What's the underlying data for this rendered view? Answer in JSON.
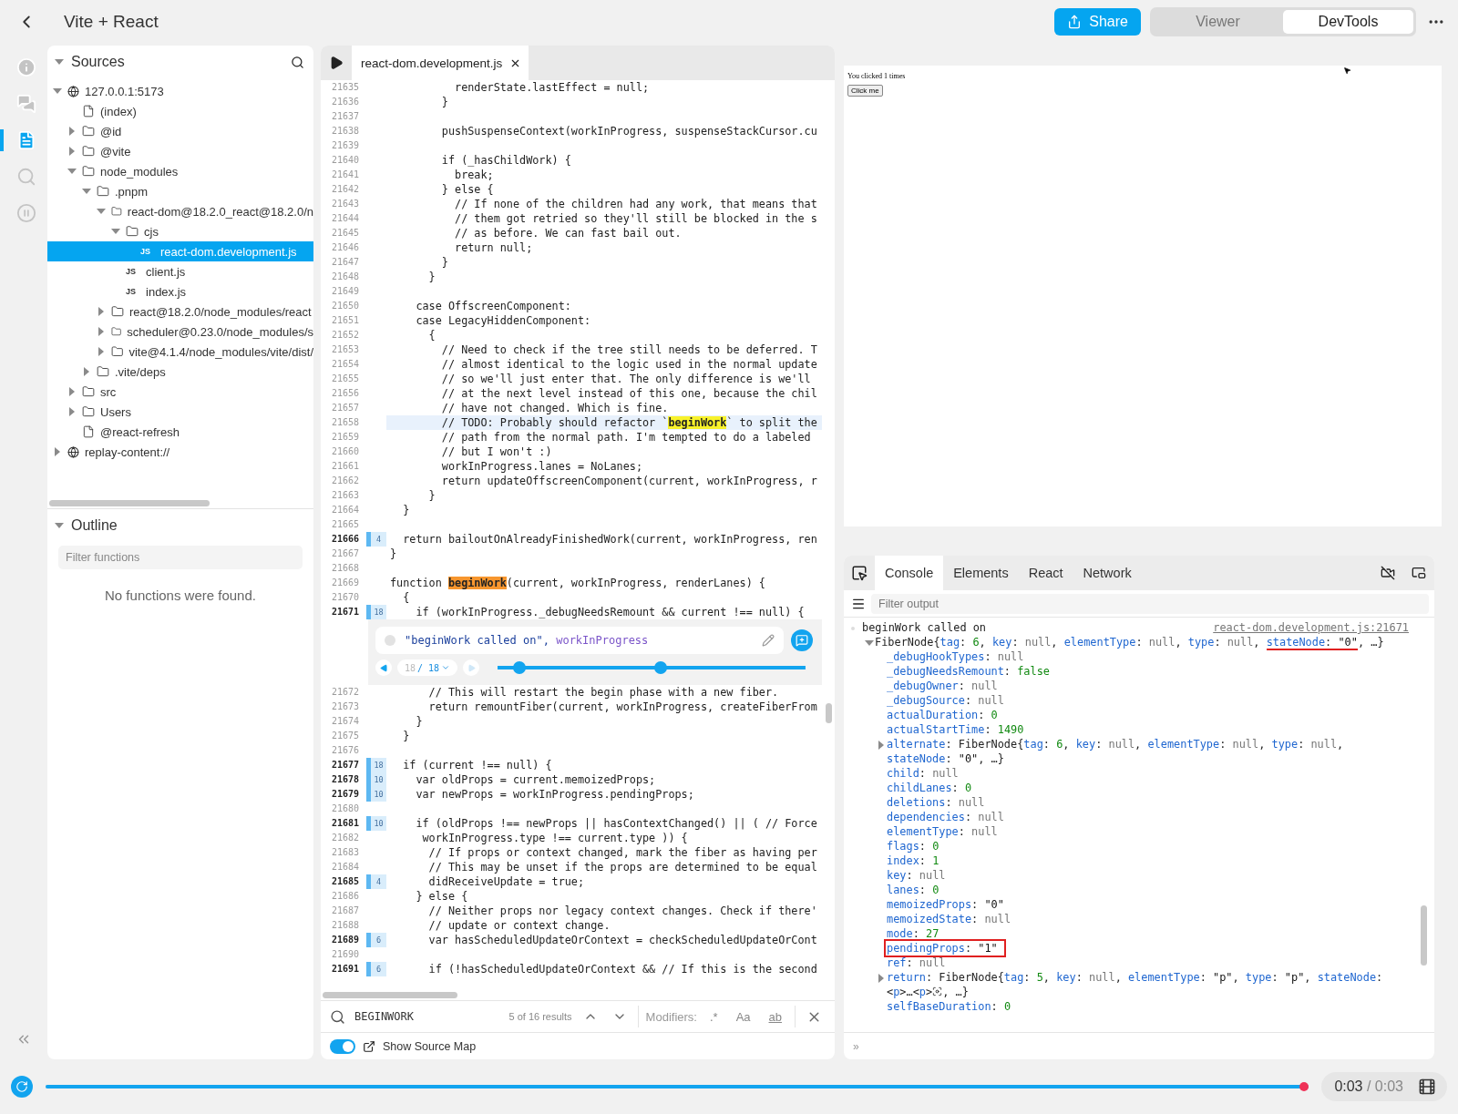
{
  "header": {
    "title": "Vite + React",
    "share": "Share",
    "modes": [
      {
        "label": "Viewer",
        "selected": false
      },
      {
        "label": "DevTools",
        "selected": true
      }
    ]
  },
  "rail": [
    {
      "kind": "info",
      "selected": false
    },
    {
      "kind": "comments",
      "selected": false
    },
    {
      "kind": "sources",
      "selected": true
    },
    {
      "kind": "search",
      "selected": false
    },
    {
      "kind": "pause",
      "selected": false
    }
  ],
  "sources": {
    "title": "Sources",
    "tree": [
      {
        "kind": "origin",
        "label": "127.0.0.1:5173",
        "expanded": true,
        "selected": false,
        "children": [
          {
            "kind": "file",
            "label": "(index)",
            "selected": false
          },
          {
            "kind": "folder",
            "label": "@id",
            "expanded": false,
            "selected": false
          },
          {
            "kind": "folder",
            "label": "@vite",
            "expanded": false,
            "selected": false
          },
          {
            "kind": "folder",
            "label": "node_modules",
            "expanded": true,
            "selected": false,
            "children": [
              {
                "kind": "folder",
                "label": ".pnpm",
                "expanded": true,
                "selected": false,
                "children": [
                  {
                    "kind": "folder",
                    "label": "react-dom@18.2.0_react@18.2.0/n",
                    "expanded": true,
                    "selected": false,
                    "children": [
                      {
                        "kind": "folder",
                        "label": "cjs",
                        "expanded": true,
                        "selected": false,
                        "children": [
                          {
                            "kind": "js",
                            "badge": "JS",
                            "label": "react-dom.development.js",
                            "selected": true
                          }
                        ]
                      },
                      {
                        "kind": "js",
                        "badge": "JS",
                        "label": "client.js",
                        "selected": false
                      },
                      {
                        "kind": "js",
                        "badge": "JS",
                        "label": "index.js",
                        "selected": false
                      }
                    ]
                  },
                  {
                    "kind": "folder",
                    "label": "react@18.2.0/node_modules/react",
                    "expanded": false,
                    "selected": false
                  },
                  {
                    "kind": "folder",
                    "label": "scheduler@0.23.0/node_modules/s",
                    "expanded": false,
                    "selected": false
                  },
                  {
                    "kind": "folder",
                    "label": "vite@4.1.4/node_modules/vite/dist/",
                    "expanded": false,
                    "selected": false
                  }
                ]
              },
              {
                "kind": "folder",
                "label": ".vite/deps",
                "expanded": false,
                "selected": false
              }
            ]
          },
          {
            "kind": "folder",
            "label": "src",
            "expanded": false,
            "selected": false
          },
          {
            "kind": "folder",
            "label": "Users",
            "expanded": false,
            "selected": false
          },
          {
            "kind": "file",
            "label": "@react-refresh",
            "selected": false
          }
        ]
      },
      {
        "kind": "origin",
        "label": "replay-content://",
        "expanded": false,
        "selected": false
      }
    ]
  },
  "outline": {
    "title": "Outline",
    "placeholder": "Filter functions",
    "empty": "No functions were found."
  },
  "editor": {
    "tab": {
      "label": "react-dom.development.js",
      "selected": true
    },
    "lines": [
      {
        "num": "21635",
        "text": "          renderState.lastEffect = null;",
        "highlighted": false
      },
      {
        "num": "21636",
        "text": "        }",
        "highlighted": false
      },
      {
        "num": "21637",
        "highlighted": false
      },
      {
        "num": "21638",
        "text": "        pushSuspenseContext(workInProgress, suspenseStackCursor.cu",
        "highlighted": false
      },
      {
        "num": "21639",
        "highlighted": false
      },
      {
        "num": "21640",
        "text": "        if (_hasChildWork) {",
        "highlighted": false
      },
      {
        "num": "21641",
        "text": "          break;",
        "highlighted": false
      },
      {
        "num": "21642",
        "text": "        } else {",
        "highlighted": false
      },
      {
        "num": "21643",
        "text": "          // If none of the children had any work, that means that",
        "highlighted": false
      },
      {
        "num": "21644",
        "text": "          // them got retried so they'll still be blocked in the s",
        "highlighted": false
      },
      {
        "num": "21645",
        "text": "          // as before. We can fast bail out.",
        "highlighted": false
      },
      {
        "num": "21646",
        "text": "          return null;",
        "highlighted": false
      },
      {
        "num": "21647",
        "text": "        }",
        "highlighted": false
      },
      {
        "num": "21648",
        "text": "      }",
        "highlighted": false
      },
      {
        "num": "21649",
        "highlighted": false
      },
      {
        "num": "21650",
        "text": "    case OffscreenComponent:",
        "highlighted": false
      },
      {
        "num": "21651",
        "text": "    case LegacyHiddenComponent:",
        "highlighted": false
      },
      {
        "num": "21652",
        "text": "      {",
        "highlighted": false
      },
      {
        "num": "21653",
        "text": "        // Need to check if the tree still needs to be deferred. T",
        "highlighted": false
      },
      {
        "num": "21654",
        "text": "        // almost identical to the logic used in the normal update",
        "highlighted": false
      },
      {
        "num": "21655",
        "text": "        // so we'll just enter that. The only difference is we'll",
        "highlighted": false
      },
      {
        "num": "21656",
        "text": "        // at the next level instead of this one, because the chil",
        "highlighted": false
      },
      {
        "num": "21657",
        "text": "        // have not changed. Which is fine.",
        "highlighted": false
      },
      {
        "num": "21658",
        "text": "        // TODO: Probably should refactor `",
        "match": {
          "text": "beginWork",
          "current": false
        },
        "after": "` to split the",
        "highlighted": true
      },
      {
        "num": "21659",
        "text": "        // path from the normal path. I'm tempted to do a labeled",
        "highlighted": false
      },
      {
        "num": "21660",
        "text": "        // but I won't :)",
        "highlighted": false
      },
      {
        "num": "21661",
        "text": "        workInProgress.lanes = NoLanes;",
        "highlighted": false
      },
      {
        "num": "21662",
        "text": "        return updateOffscreenComponent(current, workInProgress, r",
        "highlighted": false
      },
      {
        "num": "21663",
        "text": "      }",
        "highlighted": false
      },
      {
        "num": "21664",
        "text": "  }",
        "highlighted": false
      },
      {
        "num": "21665",
        "highlighted": false
      },
      {
        "num": "21666",
        "hits": "4",
        "text": "  return bailoutOnAlreadyFinishedWork(current, workInProgress, ren",
        "highlighted": false
      },
      {
        "num": "21667",
        "text": "}",
        "highlighted": false
      },
      {
        "num": "21668",
        "highlighted": false
      },
      {
        "num": "21669",
        "text": "function ",
        "match": {
          "text": "beginWork",
          "current": true
        },
        "after": "(current, workInProgress, renderLanes) {",
        "highlighted": false
      },
      {
        "num": "21670",
        "text": "  {",
        "highlighted": false
      },
      {
        "num": "21671",
        "hits": "18",
        "text": "    if (workInProgress._debugNeedsRemount && current !== null) {",
        "highlighted": false,
        "logpoint": {
          "expression": [
            {
              "kind": "string",
              "text": "\"beginWork called on\","
            },
            {
              "kind": "variable",
              "text": " workInProgress"
            }
          ],
          "counter_current": "18",
          "counter_total": "/ 18",
          "thumbs": [
            {
              "level": 0.07
            },
            {
              "level": 0.53
            }
          ]
        }
      },
      {
        "num": "21672",
        "text": "      // This will restart the begin phase with a new fiber.",
        "highlighted": false
      },
      {
        "num": "21673",
        "text": "      return remountFiber(current, workInProgress, createFiberFrom",
        "highlighted": false
      },
      {
        "num": "21674",
        "text": "    }",
        "highlighted": false
      },
      {
        "num": "21675",
        "text": "  }",
        "highlighted": false
      },
      {
        "num": "21676",
        "highlighted": false
      },
      {
        "num": "21677",
        "hits": "18",
        "text": "  if (current !== null) {",
        "highlighted": false
      },
      {
        "num": "21678",
        "hits": "10",
        "text": "    var oldProps = current.memoizedProps;",
        "highlighted": false
      },
      {
        "num": "21679",
        "hits": "10",
        "text": "    var newProps = workInProgress.pendingProps;",
        "highlighted": false
      },
      {
        "num": "21680",
        "highlighted": false
      },
      {
        "num": "21681",
        "hits": "10",
        "text": "    if (oldProps !== newProps || hasContextChanged() || ( // Force",
        "highlighted": false
      },
      {
        "num": "21682",
        "text": "     workInProgress.type !== current.type )) {",
        "highlighted": false
      },
      {
        "num": "21683",
        "text": "      // If props or context changed, mark the fiber as having per",
        "highlighted": false
      },
      {
        "num": "21684",
        "text": "      // This may be unset if the props are determined to be equal",
        "highlighted": false
      },
      {
        "num": "21685",
        "hits": "4",
        "text": "      didReceiveUpdate = true;",
        "highlighted": false
      },
      {
        "num": "21686",
        "text": "    } else {",
        "highlighted": false
      },
      {
        "num": "21687",
        "text": "      // Neither props nor legacy context changes. Check if there'",
        "highlighted": false
      },
      {
        "num": "21688",
        "text": "      // update or context change.",
        "highlighted": false
      },
      {
        "num": "21689",
        "hits": "6",
        "text": "      var hasScheduledUpdateOrContext = checkScheduledUpdateOrCont",
        "highlighted": false
      },
      {
        "num": "21690",
        "highlighted": false
      },
      {
        "num": "21691",
        "hits": "6",
        "text": "      if (!hasScheduledUpdateOrContext && // If this is the second",
        "highlighted": false
      }
    ],
    "search": {
      "query": "BEGINWORK",
      "results": "5 of 16 results",
      "modifiers_label": "Modifiers:",
      "modifiers": [
        {
          "kind": "regex",
          "label": ".*"
        },
        {
          "kind": "case",
          "label": "Aa"
        },
        {
          "kind": "word",
          "label": "ab"
        }
      ]
    },
    "source_map": {
      "label": "Show Source Map",
      "on": true
    }
  },
  "preview": {
    "text": "You clicked 1 times",
    "button": "Click me"
  },
  "console": {
    "tabs": [
      {
        "label": "Console",
        "selected": true
      },
      {
        "label": "Elements",
        "selected": false
      },
      {
        "label": "React",
        "selected": false
      },
      {
        "label": "Network",
        "selected": false
      }
    ],
    "placeholder": "Filter output",
    "prompt": "»",
    "entries": [
      {
        "message": "beginWork called on",
        "source": "react-dom.development.js:21671",
        "rows": [
          {
            "kind": "object",
            "expanded": true,
            "underlined": true,
            "tokens": [
              {
                "kind": "plain",
                "text": "FiberNode{"
              },
              {
                "kind": "key",
                "text": "tag"
              },
              {
                "kind": "plain",
                "text": ": "
              },
              {
                "kind": "number",
                "text": "6"
              },
              {
                "kind": "plain",
                "text": ", "
              },
              {
                "kind": "key",
                "text": "key"
              },
              {
                "kind": "plain",
                "text": ": "
              },
              {
                "kind": "null",
                "text": "null"
              },
              {
                "kind": "plain",
                "text": ", "
              },
              {
                "kind": "key",
                "text": "elementType"
              },
              {
                "kind": "plain",
                "text": ": "
              },
              {
                "kind": "null",
                "text": "null"
              },
              {
                "kind": "plain",
                "text": ", "
              },
              {
                "kind": "key",
                "text": "type"
              },
              {
                "kind": "plain",
                "text": ": "
              },
              {
                "kind": "null",
                "text": "null"
              },
              {
                "kind": "plain",
                "text": ", "
              }
            ],
            "marked": [
              {
                "kind": "key",
                "text": "stateNode"
              },
              {
                "kind": "plain",
                "text": ": "
              },
              {
                "kind": "string",
                "text": "\"0\""
              }
            ],
            "rest": [
              {
                "kind": "plain",
                "text": ", …}"
              }
            ],
            "children": [
              {
                "kind": "value",
                "tokens": [
                  {
                    "kind": "key",
                    "text": "_debugHookTypes"
                  },
                  {
                    "kind": "plain",
                    "text": ": "
                  },
                  {
                    "kind": "null",
                    "text": "null"
                  }
                ]
              },
              {
                "kind": "value",
                "tokens": [
                  {
                    "kind": "key",
                    "text": "_debugNeedsRemount"
                  },
                  {
                    "kind": "plain",
                    "text": ": "
                  },
                  {
                    "kind": "number",
                    "text": "false"
                  }
                ]
              },
              {
                "kind": "value",
                "tokens": [
                  {
                    "kind": "key",
                    "text": "_debugOwner"
                  },
                  {
                    "kind": "plain",
                    "text": ": "
                  },
                  {
                    "kind": "null",
                    "text": "null"
                  }
                ]
              },
              {
                "kind": "value",
                "tokens": [
                  {
                    "kind": "key",
                    "text": "_debugSource"
                  },
                  {
                    "kind": "plain",
                    "text": ": "
                  },
                  {
                    "kind": "null",
                    "text": "null"
                  }
                ]
              },
              {
                "kind": "value",
                "tokens": [
                  {
                    "kind": "key",
                    "text": "actualDuration"
                  },
                  {
                    "kind": "plain",
                    "text": ": "
                  },
                  {
                    "kind": "number",
                    "text": "0"
                  }
                ]
              },
              {
                "kind": "value",
                "tokens": [
                  {
                    "kind": "key",
                    "text": "actualStartTime"
                  },
                  {
                    "kind": "plain",
                    "text": ": "
                  },
                  {
                    "kind": "number",
                    "text": "1490"
                  }
                ]
              },
              {
                "kind": "object",
                "expanded": false,
                "tokens": [
                  {
                    "kind": "key",
                    "text": "alternate"
                  },
                  {
                    "kind": "plain",
                    "text": ": FiberNode{"
                  },
                  {
                    "kind": "key",
                    "text": "tag"
                  },
                  {
                    "kind": "plain",
                    "text": ": "
                  },
                  {
                    "kind": "number",
                    "text": "6"
                  },
                  {
                    "kind": "plain",
                    "text": ", "
                  },
                  {
                    "kind": "key",
                    "text": "key"
                  },
                  {
                    "kind": "plain",
                    "text": ": "
                  },
                  {
                    "kind": "null",
                    "text": "null"
                  },
                  {
                    "kind": "plain",
                    "text": ", "
                  },
                  {
                    "kind": "key",
                    "text": "elementType"
                  },
                  {
                    "kind": "plain",
                    "text": ": "
                  },
                  {
                    "kind": "null",
                    "text": "null"
                  },
                  {
                    "kind": "plain",
                    "text": ", "
                  },
                  {
                    "kind": "key",
                    "text": "type"
                  },
                  {
                    "kind": "plain",
                    "text": ": "
                  },
                  {
                    "kind": "null",
                    "text": "null"
                  },
                  {
                    "kind": "plain",
                    "text": ", "
                  },
                  {
                    "kind": "key",
                    "text": "stateNode"
                  },
                  {
                    "kind": "plain",
                    "text": ": "
                  },
                  {
                    "kind": "string",
                    "text": "\"0\""
                  },
                  {
                    "kind": "plain",
                    "text": ", …}"
                  }
                ]
              },
              {
                "kind": "value",
                "tokens": [
                  {
                    "kind": "key",
                    "text": "child"
                  },
                  {
                    "kind": "plain",
                    "text": ": "
                  },
                  {
                    "kind": "null",
                    "text": "null"
                  }
                ]
              },
              {
                "kind": "value",
                "tokens": [
                  {
                    "kind": "key",
                    "text": "childLanes"
                  },
                  {
                    "kind": "plain",
                    "text": ": "
                  },
                  {
                    "kind": "number",
                    "text": "0"
                  }
                ]
              },
              {
                "kind": "value",
                "tokens": [
                  {
                    "kind": "key",
                    "text": "deletions"
                  },
                  {
                    "kind": "plain",
                    "text": ": "
                  },
                  {
                    "kind": "null",
                    "text": "null"
                  }
                ]
              },
              {
                "kind": "value",
                "tokens": [
                  {
                    "kind": "key",
                    "text": "dependencies"
                  },
                  {
                    "kind": "plain",
                    "text": ": "
                  },
                  {
                    "kind": "null",
                    "text": "null"
                  }
                ]
              },
              {
                "kind": "value",
                "tokens": [
                  {
                    "kind": "key",
                    "text": "elementType"
                  },
                  {
                    "kind": "plain",
                    "text": ": "
                  },
                  {
                    "kind": "null",
                    "text": "null"
                  }
                ]
              },
              {
                "kind": "value",
                "tokens": [
                  {
                    "kind": "key",
                    "text": "flags"
                  },
                  {
                    "kind": "plain",
                    "text": ": "
                  },
                  {
                    "kind": "number",
                    "text": "0"
                  }
                ]
              },
              {
                "kind": "value",
                "tokens": [
                  {
                    "kind": "key",
                    "text": "index"
                  },
                  {
                    "kind": "plain",
                    "text": ": "
                  },
                  {
                    "kind": "number",
                    "text": "1"
                  }
                ]
              },
              {
                "kind": "value",
                "tokens": [
                  {
                    "kind": "key",
                    "text": "key"
                  },
                  {
                    "kind": "plain",
                    "text": ": "
                  },
                  {
                    "kind": "null",
                    "text": "null"
                  }
                ]
              },
              {
                "kind": "value",
                "tokens": [
                  {
                    "kind": "key",
                    "text": "lanes"
                  },
                  {
                    "kind": "plain",
                    "text": ": "
                  },
                  {
                    "kind": "number",
                    "text": "0"
                  }
                ]
              },
              {
                "kind": "value",
                "tokens": [
                  {
                    "kind": "key",
                    "text": "memoizedProps"
                  },
                  {
                    "kind": "plain",
                    "text": ": "
                  },
                  {
                    "kind": "string",
                    "text": "\"0\""
                  }
                ]
              },
              {
                "kind": "value",
                "tokens": [
                  {
                    "kind": "key",
                    "text": "memoizedState"
                  },
                  {
                    "kind": "plain",
                    "text": ": "
                  },
                  {
                    "kind": "null",
                    "text": "null"
                  }
                ]
              },
              {
                "kind": "value",
                "tokens": [
                  {
                    "kind": "key",
                    "text": "mode"
                  },
                  {
                    "kind": "plain",
                    "text": ": "
                  },
                  {
                    "kind": "number",
                    "text": "27"
                  }
                ]
              },
              {
                "kind": "value",
                "boxed": true,
                "marked": [
                  {
                    "kind": "key",
                    "text": "pendingProps"
                  },
                  {
                    "kind": "plain",
                    "text": ": "
                  },
                  {
                    "kind": "string",
                    "text": "\"1\""
                  }
                ]
              },
              {
                "kind": "value",
                "tokens": [
                  {
                    "kind": "key",
                    "text": "ref"
                  },
                  {
                    "kind": "plain",
                    "text": ": "
                  },
                  {
                    "kind": "null",
                    "text": "null"
                  }
                ]
              },
              {
                "kind": "object",
                "expanded": false,
                "tokens": [
                  {
                    "kind": "key",
                    "text": "return"
                  },
                  {
                    "kind": "plain",
                    "text": ": FiberNode{"
                  },
                  {
                    "kind": "key",
                    "text": "tag"
                  },
                  {
                    "kind": "plain",
                    "text": ": "
                  },
                  {
                    "kind": "number",
                    "text": "5"
                  },
                  {
                    "kind": "plain",
                    "text": ", "
                  },
                  {
                    "kind": "key",
                    "text": "key"
                  },
                  {
                    "kind": "plain",
                    "text": ": "
                  },
                  {
                    "kind": "null",
                    "text": "null"
                  },
                  {
                    "kind": "plain",
                    "text": ", "
                  },
                  {
                    "kind": "key",
                    "text": "elementType"
                  },
                  {
                    "kind": "plain",
                    "text": ": "
                  },
                  {
                    "kind": "string",
                    "text": "\"p\""
                  },
                  {
                    "kind": "plain",
                    "text": ", "
                  },
                  {
                    "kind": "key",
                    "text": "type"
                  },
                  {
                    "kind": "plain",
                    "text": ": "
                  },
                  {
                    "kind": "string",
                    "text": "\"p\""
                  },
                  {
                    "kind": "plain",
                    "text": ", "
                  },
                  {
                    "kind": "key",
                    "text": "stateNode"
                  },
                  {
                    "kind": "plain",
                    "text": ": <"
                  },
                  {
                    "kind": "key",
                    "text": "p"
                  },
                  {
                    "kind": "plain",
                    "text": ">…<"
                  },
                  {
                    "kind": "key",
                    "text": "p"
                  },
                  {
                    "kind": "plain",
                    "text": ">"
                  },
                  {
                    "kind": "icon"
                  },
                  {
                    "kind": "plain",
                    "text": ", …}"
                  }
                ]
              },
              {
                "kind": "value",
                "tokens": [
                  {
                    "kind": "key",
                    "text": "selfBaseDuration"
                  },
                  {
                    "kind": "plain",
                    "text": ": "
                  },
                  {
                    "kind": "number",
                    "text": "0"
                  }
                ]
              }
            ]
          }
        ]
      }
    ]
  },
  "timeline": {
    "level": 1,
    "current": "0:03",
    "total": "/ 0:03"
  }
}
